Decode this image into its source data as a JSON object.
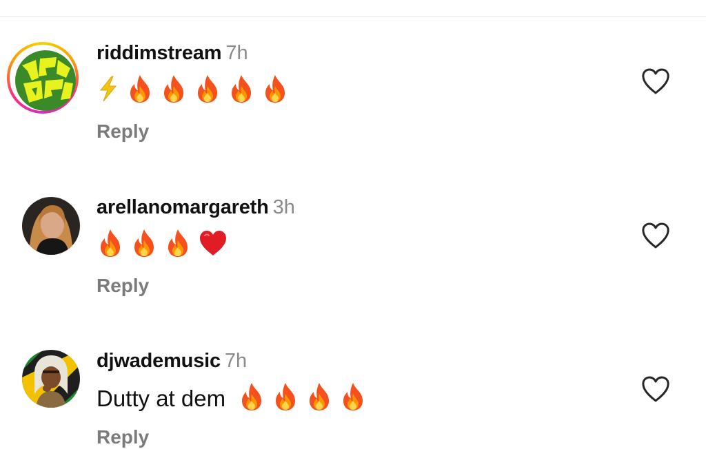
{
  "comments": [
    {
      "username": "riddimstream",
      "time": "7h",
      "text": "",
      "emojis": [
        "zap",
        "fire",
        "fire",
        "fire",
        "fire",
        "fire"
      ],
      "reply_label": "Reply"
    },
    {
      "username": "arellanomargareth",
      "time": "3h",
      "text": "",
      "emojis": [
        "fire",
        "fire",
        "fire",
        "red-heart"
      ],
      "reply_label": "Reply"
    },
    {
      "username": "djwademusic",
      "time": "7h",
      "text": "Dutty at dem",
      "emojis": [
        "fire",
        "fire",
        "fire",
        "fire"
      ],
      "reply_label": "Reply"
    }
  ],
  "icons": {
    "like": "heart-outline-icon"
  },
  "colors": {
    "username": "#111111",
    "timestamp": "#8a8a8a",
    "reply": "#7b7b7b",
    "story_ring": "#ff2d7a"
  }
}
